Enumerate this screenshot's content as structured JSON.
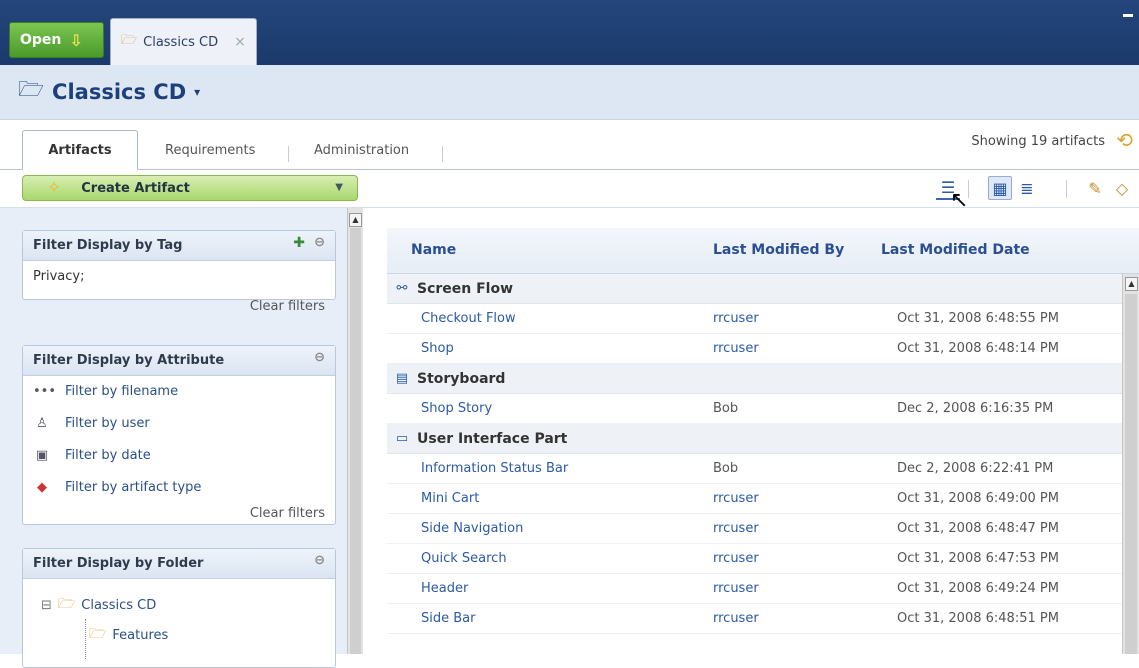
{
  "topbar": {
    "open_label": "Open",
    "doc_tab_label": "Classics CD"
  },
  "title": {
    "text": "Classics CD"
  },
  "tabs": [
    "Artifacts",
    "Requirements",
    "Administration"
  ],
  "showing_text": "Showing 19 artifacts",
  "toolbar": {
    "create_label": "Create Artifact"
  },
  "filters": {
    "tag": {
      "title": "Filter Display by Tag",
      "value": "Privacy;",
      "clear": "Clear filters"
    },
    "attribute": {
      "title": "Filter Display by Attribute",
      "items": [
        "Filter by filename",
        "Filter by user",
        "Filter by date",
        "Filter by artifact type"
      ],
      "clear": "Clear filters"
    },
    "folder": {
      "title": "Filter Display by Folder",
      "root": "Classics CD",
      "child": "Features"
    }
  },
  "table": {
    "columns": [
      "Name",
      "Last Modified By",
      "Last Modified Date"
    ],
    "groups": [
      "Screen Flow",
      "Storyboard",
      "User Interface Part"
    ],
    "rows": [
      [
        "Checkout Flow",
        "rrcuser",
        "Oct 31, 2008 6:48:55 PM"
      ],
      [
        "Shop",
        "rrcuser",
        "Oct 31, 2008 6:48:14 PM"
      ],
      [
        "Shop Story",
        "Bob",
        "Dec 2, 2008 6:16:35 PM"
      ],
      [
        "Information Status Bar",
        "Bob",
        "Dec 2, 2008 6:22:41 PM"
      ],
      [
        "Mini Cart",
        "rrcuser",
        "Oct 31, 2008 6:49:00 PM"
      ],
      [
        "Side Navigation",
        "rrcuser",
        "Oct 31, 2008 6:48:47 PM"
      ],
      [
        "Quick Search",
        "rrcuser",
        "Oct 31, 2008 6:47:53 PM"
      ],
      [
        "Header",
        "rrcuser",
        "Oct 31, 2008 6:49:24 PM"
      ],
      [
        "Side Bar",
        "rrcuser",
        "Oct 31, 2008 6:48:51 PM"
      ]
    ]
  },
  "colors": {
    "topbar": "#1e3f72",
    "accent_green": "#5aab34",
    "link_blue": "#2b5aa6",
    "panel_bg": "#e7eef7"
  }
}
